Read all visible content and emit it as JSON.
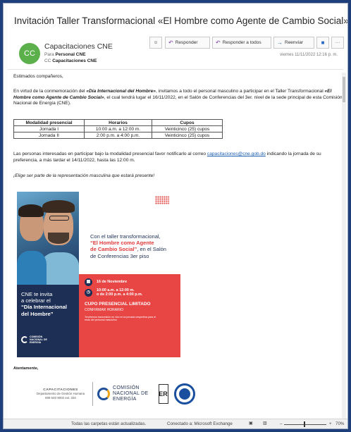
{
  "subject": "Invitación Taller Transformacional «El Hombre como Agente de Cambio Social»",
  "sender": {
    "name": "Capacitaciones CNE",
    "initials": "CC",
    "to_label": "Para",
    "to": "Personal CNE",
    "cc_label": "CC",
    "cc": "Capacitaciones CNE"
  },
  "toolbar": {
    "reply": "Responder",
    "reply_all": "Responder a todos",
    "forward": "Reenviar",
    "more": "···"
  },
  "date": "viernes 11/11/2022 12:16 p. m.",
  "body": {
    "greeting": "Estimados compañeros,",
    "p1_a": "En virtud de la conmemoración del ",
    "p1_b": "«Día Internacional del Hombre»",
    "p1_c": ", invitamos a todo el personal masculino a participar en el Taller Transformacional ",
    "p1_d": "«El Hombre como Agente de Cambio Social»",
    "p1_e": ", el cual tendrá lugar el 16/11/2022, en el Salón de Conferencias del 3er. nivel de la sede principal de esta Comisión Nacional de Energía (CNE).",
    "p2_a": "Las personas interesadas en participar bajo la modalidad presencial favor notificarlo al correo ",
    "p2_email": "capacitaciones@cne.gob.do",
    "p2_b": " indicando la jornada de su preferencia, a más tardar el 14/11/2022, hasta las 12:00 m.",
    "slogan": "¡Elige ser parte de la representación masculina que estará presente!"
  },
  "table": {
    "headers": [
      "Modalidad presencial",
      "Horarios",
      "Cupos"
    ],
    "rows": [
      [
        "Jornada I",
        "10:00 a.m. a 12:00 m.",
        "Veinticinco (25) cupos"
      ],
      [
        "Jornada II",
        "2:00 p.m. a 4:00 p.m.",
        "Veinticinco (25) cupos"
      ]
    ]
  },
  "poster": {
    "intro_1": "Con el taller transformacional,",
    "intro_title_1": "“El Hombre como Agente",
    "intro_title_2": "de Cambio Social”",
    "intro_2": ", en el Salón",
    "intro_3": "de Conferencias 3er piso",
    "date": "16 de Noviembre",
    "time_1": "10:00 a.m. a 12:00 m.",
    "time_2": "o de 2:00 p.m. a 4:00 p.m.",
    "cupo": "CUPO PRESENCIAL LIMITADO",
    "confirm": "CONFIRMAR HORARIO",
    "transmission": "Tendremos transmisión en vivo en la jornada vespertina para el resto del personal masculino",
    "invite_1": "CNE te invita",
    "invite_2": "a celebrar el",
    "invite_3": "“Día Internacional",
    "invite_4": "del Hombre”",
    "logo_1": "COMISIÓN",
    "logo_2": "NACIONAL DE",
    "logo_3": "ENERGÍA"
  },
  "signature": {
    "closing": "Atentamente,",
    "cap_title": "CAPACITACIONES",
    "cap_dept": "Departamento de Gestión Humana",
    "cap_phone": "809 540 9002 ext. 334",
    "cne_1": "COMISIÓN",
    "cne_2": "NACIONAL DE",
    "cne_3": "ENERGÍA",
    "er": "ER"
  },
  "status": {
    "folders": "Todas las carpetas están actualizadas.",
    "connection": "Conectado a: Microsoft Exchange",
    "zoom_minus": "–",
    "zoom_plus": "+",
    "zoom": "70%"
  }
}
